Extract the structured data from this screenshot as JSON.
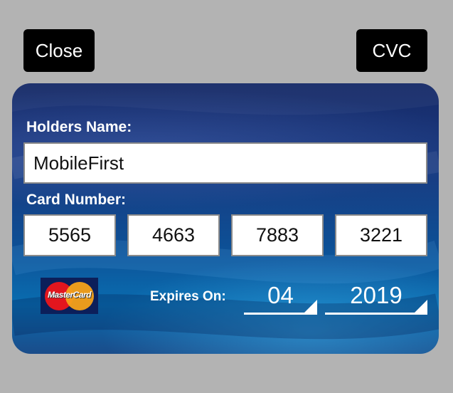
{
  "buttons": {
    "close_label": "Close",
    "cvc_label": "CVC"
  },
  "card": {
    "holder_label": "Holders Name:",
    "holder_value": "MobileFirst",
    "number_label": "Card Number:",
    "number_groups": [
      "5565",
      "4663",
      "7883",
      "3221"
    ],
    "brand_logo_text": "MasterCard",
    "expires_label": "Expires On:",
    "expiry_month": "04",
    "expiry_year": "2019"
  },
  "colors": {
    "background": "#b3b3b3",
    "button_bg": "#000000",
    "card_dark": "#162a68",
    "card_light": "#0a6db0"
  }
}
